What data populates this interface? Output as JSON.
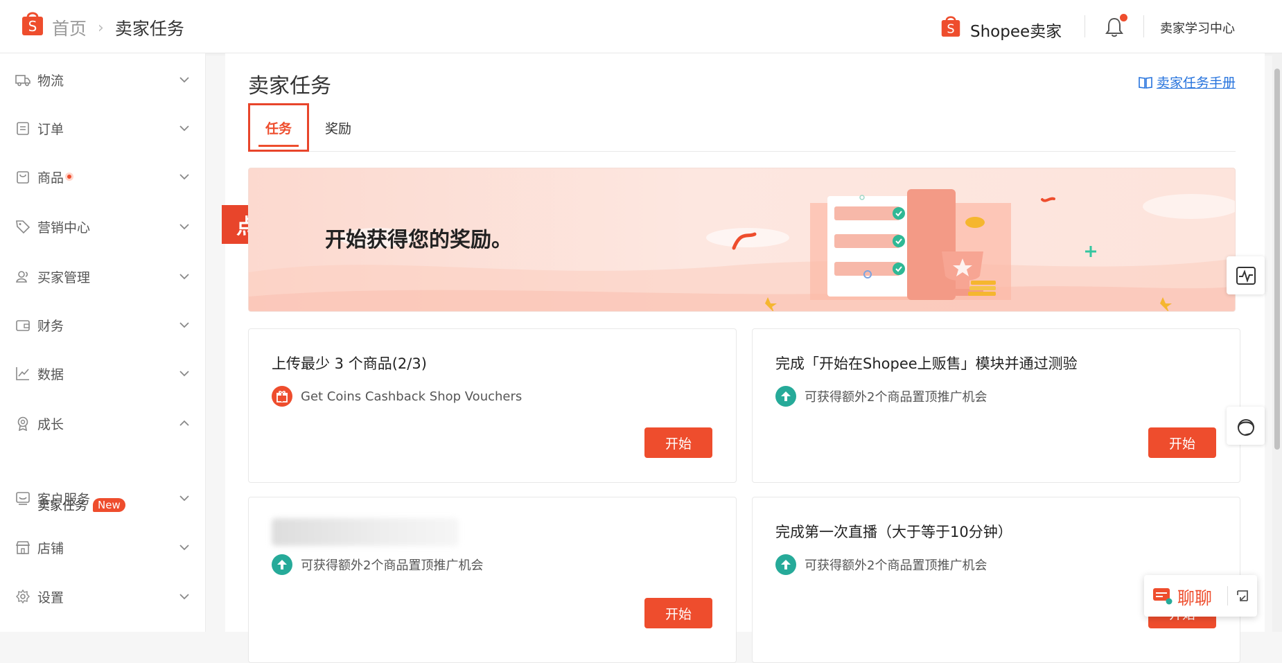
{
  "header": {
    "breadcrumb_home": "首页",
    "breadcrumb_separator": "›",
    "breadcrumb_current": "卖家任务",
    "brand_name": "Shopee卖家",
    "learning_center": "卖家学习中心",
    "logo_letter": "S",
    "notification_dot": true
  },
  "sidebar": {
    "items": [
      {
        "label": "物流",
        "icon": "truck-icon"
      },
      {
        "label": "订单",
        "icon": "clipboard-icon"
      },
      {
        "label": "商品",
        "icon": "bag-icon",
        "dot": true
      },
      {
        "label": "营销中心",
        "icon": "tag-icon"
      },
      {
        "label": "买家管理",
        "icon": "users-icon"
      },
      {
        "label": "财务",
        "icon": "wallet-icon"
      },
      {
        "label": "数据",
        "icon": "chart-icon"
      },
      {
        "label": "成长",
        "icon": "medal-icon",
        "expanded": true
      },
      {
        "label": "客户服务",
        "icon": "support-icon"
      },
      {
        "label": "店铺",
        "icon": "store-icon"
      },
      {
        "label": "设置",
        "icon": "gear-icon"
      }
    ],
    "sub_item": {
      "label": "卖家任务",
      "badge": "New"
    }
  },
  "main": {
    "title": "卖家任务",
    "manual_link": "卖家任务手册",
    "tabs": [
      {
        "label": "任务",
        "active": true
      },
      {
        "label": "奖励",
        "active": false
      }
    ],
    "callout": "点击【任务】",
    "banner_text": "开始获得您的奖励。",
    "tasks": [
      {
        "title": "上传最少 3 个商品(2/3)",
        "reward": "Get Coins Cashback Shop Vouchers",
        "reward_icon": "gift-icon",
        "button": "开始"
      },
      {
        "title": "完成「开始在Shopee上贩售」模块并通过测验",
        "reward": "可获得额外2个商品置顶推广机会",
        "reward_icon": "boost-icon",
        "button": "开始"
      },
      {
        "title": "",
        "reward": "可获得额外2个商品置顶推广机会",
        "reward_icon": "boost-icon",
        "button": "开始",
        "title_blurred": true
      },
      {
        "title": "完成第一次直播（大于等于10分钟）",
        "reward": "可获得额外2个商品置顶推广机会",
        "reward_icon": "boost-icon",
        "button": "开始"
      }
    ]
  },
  "chat": {
    "label": "聊聊"
  },
  "colors": {
    "accent": "#ee4d2d",
    "teal": "#26aa99",
    "link": "#2673dd"
  }
}
